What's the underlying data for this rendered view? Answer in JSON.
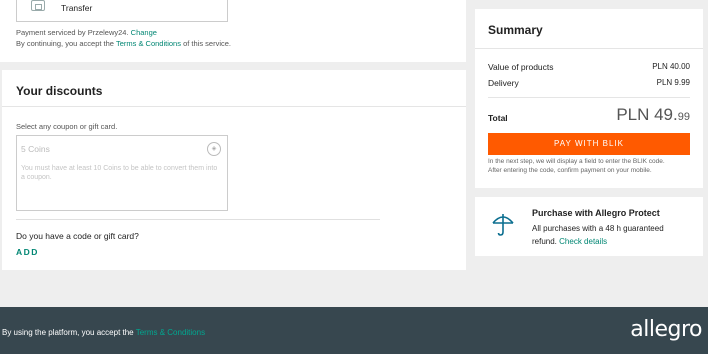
{
  "payment": {
    "method_label": "Transfer",
    "serviced_prefix": "Payment serviced by Przelewy24.",
    "change_link": "Change",
    "accept_prefix": "By continuing, you accept the",
    "accept_link": "Terms & Conditions",
    "accept_suffix": "of this service."
  },
  "discounts": {
    "title": "Your discounts",
    "hint": "Select any coupon or gift card.",
    "coins_title": "5 Coins",
    "coins_desc": "You must have at least 10 Coins to be able to convert them into a coupon.",
    "question": "Do you have a code or gift card?",
    "add_label": "ADD"
  },
  "summary": {
    "title": "Summary",
    "value_label": "Value of products",
    "value_amount": "PLN 40.00",
    "delivery_label": "Delivery",
    "delivery_amount": "PLN 9.99",
    "total_label": "Total",
    "total_main": "PLN 49.",
    "total_cents": "99",
    "pay_button": "PAY WITH BLIK",
    "note_line1": "In the next step, we will display a field to enter the BLIK code.",
    "note_line2": "After entering the code, confirm payment on your mobile."
  },
  "protect": {
    "title": "Purchase with Allegro Protect",
    "line1": "All purchases with a 48 h guaranteed",
    "line2_prefix": "refund.",
    "details_link": "Check details"
  },
  "footer": {
    "text_prefix": "By using the platform, you accept the",
    "terms_link": "Terms & Conditions",
    "logo": "allegro"
  },
  "colors": {
    "accent": "#008673",
    "pay_button": "#ff5a00",
    "footer_bg": "#37474f"
  }
}
